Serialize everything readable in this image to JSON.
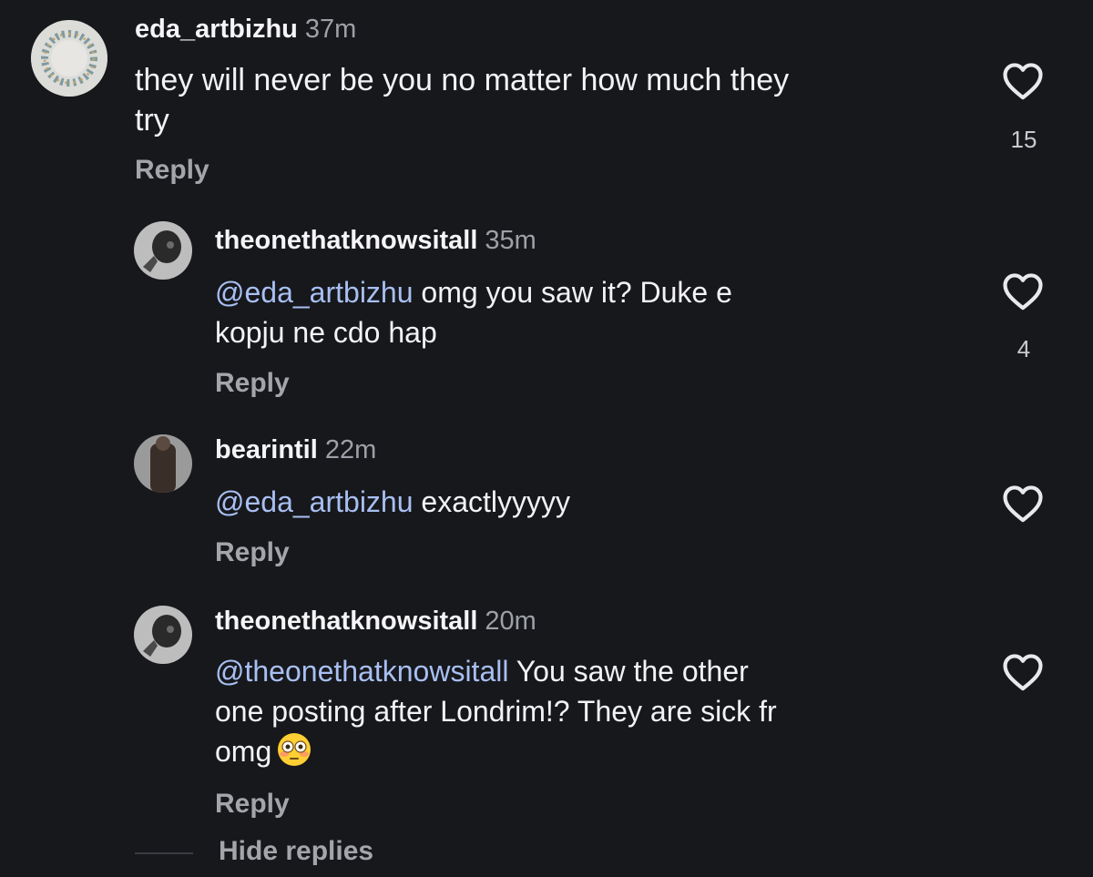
{
  "comments": [
    {
      "username": "eda_artbizhu",
      "time": "37m",
      "mention": "",
      "line1": "they will never be you no matter how much they",
      "line2": "try",
      "line3": "",
      "reply_label": "Reply",
      "likes": "15"
    },
    {
      "username": "theonethatknowsitall",
      "time": "35m",
      "mention": "@eda_artbizhu",
      "line1": " omg you saw it? Duke e",
      "line2": "kopju ne cdo hap",
      "line3": "",
      "reply_label": "Reply",
      "likes": "4"
    },
    {
      "username": "bearintil",
      "time": "22m",
      "mention": "@eda_artbizhu",
      "line1": " exactlyyyyy",
      "line2": "",
      "line3": "",
      "reply_label": "Reply",
      "likes": ""
    },
    {
      "username": "theonethatknowsitall",
      "time": "20m",
      "mention": "@theonethatknowsitall",
      "line1": " You saw the other",
      "line2": "one posting after Londrim!? They are sick fr",
      "line3": "omg",
      "emoji": "flushed-face-emoji",
      "reply_label": "Reply",
      "likes": ""
    }
  ],
  "hide_replies_label": "Hide replies",
  "colors": {
    "background": "#17181c",
    "mention": "#a8bff2",
    "secondary_text": "#9ea0a7"
  }
}
